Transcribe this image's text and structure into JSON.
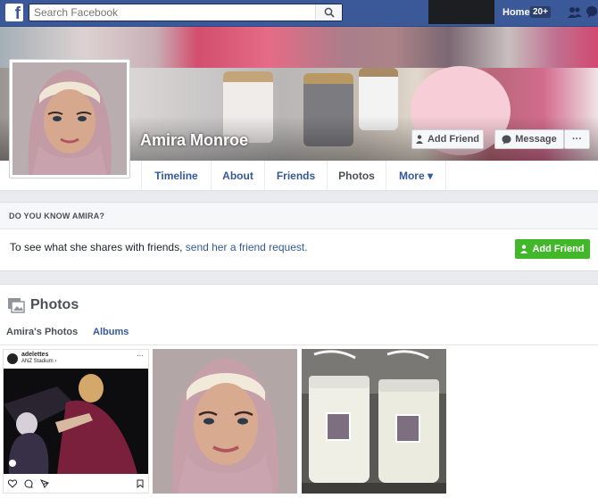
{
  "topbar": {
    "logo": "f",
    "search_placeholder": "Search Facebook",
    "home_label": "Home",
    "home_badge": "20+",
    "icons": [
      "search-icon",
      "friend-requests-icon",
      "messages-icon"
    ]
  },
  "profile": {
    "name": "Amira Monroe",
    "add_friend_label": "Add Friend",
    "message_label": "Message",
    "more_options_label": "···"
  },
  "nav": {
    "tabs": [
      {
        "label": "Timeline"
      },
      {
        "label": "About"
      },
      {
        "label": "Friends"
      },
      {
        "label": "Photos"
      },
      {
        "label": "More ▾"
      }
    ],
    "active_tab": "Photos"
  },
  "know": {
    "heading": "DO YOU KNOW AMIRA?",
    "text": "To see what she shares with friends,",
    "link": "send her a friend request.",
    "button_label": "Add Friend"
  },
  "photos": {
    "title": "Photos",
    "tabs": [
      "Amira's Photos",
      "Albums"
    ],
    "instagram": {
      "username": "adelettes",
      "location": "ANZ Stadium ›",
      "more": "···"
    }
  },
  "colors": {
    "brand": "#3b5998",
    "link": "#365899",
    "add_friend_green": "#42b72a"
  }
}
